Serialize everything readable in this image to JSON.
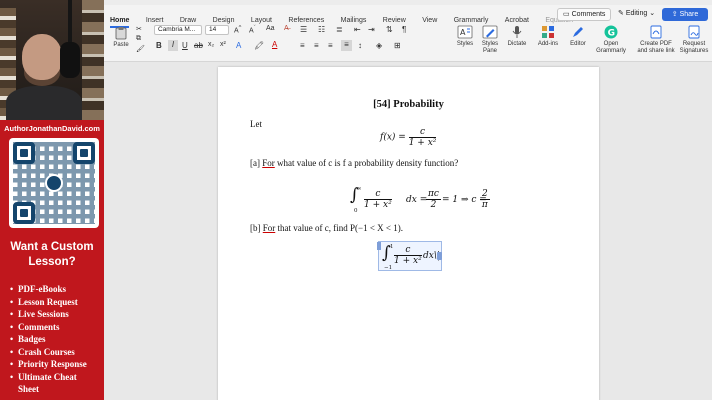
{
  "sidebar": {
    "author_url": "AuthorJonathanDavid.com",
    "cta_line1": "Want a Custom",
    "cta_line2": "Lesson?",
    "offerings": [
      "PDF-eBooks",
      "Lesson Request",
      "Live Sessions",
      "Comments",
      "Badges",
      "Crash Courses",
      "Priority Response",
      "Ultimate Cheat",
      "Sheet"
    ],
    "bullet": "•",
    "accent_color": "#c0171d"
  },
  "ribbon": {
    "tabs": [
      "Home",
      "Insert",
      "Draw",
      "Design",
      "Layout",
      "References",
      "Mailings",
      "Review",
      "View",
      "Grammarly",
      "Acrobat",
      "Equation"
    ],
    "active_tab": "Home",
    "comments_label": "Comments",
    "editing_label": "Editing",
    "share_label": "Share",
    "paste_label": "Paste",
    "font_name": "Cambria M...",
    "font_size": "14",
    "styles_label": "Styles",
    "styles_pane_label1": "Styles",
    "styles_pane_label2": "Pane",
    "dictate_label": "Dictate",
    "addins_label": "Add-ins",
    "editor_label": "Editor",
    "grammarly_label1": "Open",
    "grammarly_label2": "Grammarly",
    "create_pdf_label1": "Create PDF",
    "create_pdf_label2": "and share link",
    "request_sig_label1": "Request",
    "request_sig_label2": "Signatures",
    "share_color": "#2f69d8"
  },
  "document": {
    "heading": "[54] Probability",
    "let": "Let",
    "fx_lhs": "f(x) =",
    "fx_num": "c",
    "fx_den": "1 + x²",
    "part_a_label": "[a]",
    "part_a_for": "For",
    "part_a_text": "what value of c is f a probability density function?",
    "int_upper": "∞",
    "int_lower": "0",
    "int_num": "c",
    "int_den": "1 + x²",
    "int_dx": "dx =",
    "mid_num": "πc",
    "mid_den": "2",
    "mid_rest": "= 1 ⇒ c =",
    "res_num": "2",
    "res_den": "π",
    "part_b_label": "[b]",
    "part_b_for": "For",
    "part_b_text": "that value of c, find P(−1 < X < 1).",
    "int2_upper": "1",
    "int2_lower": "−1",
    "int2_num": "c",
    "int2_den": "1 + x²",
    "int2_dx": "dx\\|"
  }
}
